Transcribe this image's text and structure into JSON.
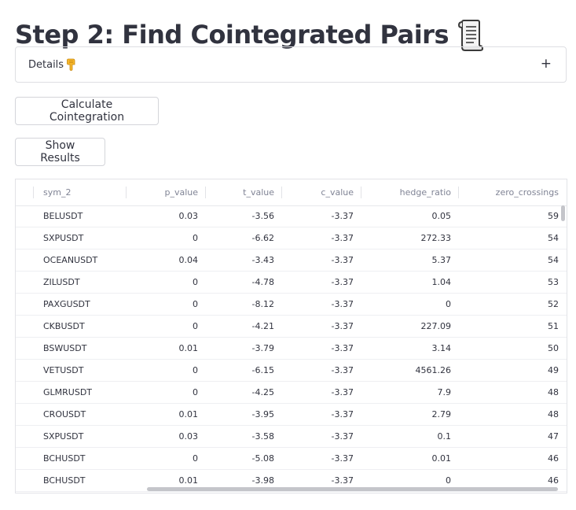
{
  "page": {
    "title": "Step 2: Find Cointegrated Pairs",
    "title_icon": "scroll-icon"
  },
  "expander": {
    "label": "Details",
    "label_icon": "pointing-down-hand-icon",
    "toggle": "+"
  },
  "buttons": {
    "calculate": "Calculate Cointegration",
    "show_results": "Show Results"
  },
  "table": {
    "columns": [
      "sym_2",
      "p_value",
      "t_value",
      "c_value",
      "hedge_ratio",
      "zero_crossings"
    ],
    "rows": [
      [
        "BELUSDT",
        "0.03",
        "-3.56",
        "-3.37",
        "0.05",
        "59"
      ],
      [
        "SXPUSDT",
        "0",
        "-6.62",
        "-3.37",
        "272.33",
        "54"
      ],
      [
        "OCEANUSDT",
        "0.04",
        "-3.43",
        "-3.37",
        "5.37",
        "54"
      ],
      [
        "ZILUSDT",
        "0",
        "-4.78",
        "-3.37",
        "1.04",
        "53"
      ],
      [
        "PAXGUSDT",
        "0",
        "-8.12",
        "-3.37",
        "0",
        "52"
      ],
      [
        "CKBUSDT",
        "0",
        "-4.21",
        "-3.37",
        "227.09",
        "51"
      ],
      [
        "BSWUSDT",
        "0.01",
        "-3.79",
        "-3.37",
        "3.14",
        "50"
      ],
      [
        "VETUSDT",
        "0",
        "-6.15",
        "-3.37",
        "4561.26",
        "49"
      ],
      [
        "GLMRUSDT",
        "0",
        "-4.25",
        "-3.37",
        "7.9",
        "48"
      ],
      [
        "CROUSDT",
        "0.01",
        "-3.95",
        "-3.37",
        "2.79",
        "48"
      ],
      [
        "SXPUSDT",
        "0.03",
        "-3.58",
        "-3.37",
        "0.1",
        "47"
      ],
      [
        "BCHUSDT",
        "0",
        "-5.08",
        "-3.37",
        "0.01",
        "46"
      ],
      [
        "BCHUSDT",
        "0.01",
        "-3.98",
        "-3.37",
        "0",
        "46"
      ]
    ]
  },
  "colors": {
    "text": "#31333f",
    "muted_header": "#808495",
    "border": "#dedfe3",
    "scrollbar": "#c4c5ca"
  }
}
